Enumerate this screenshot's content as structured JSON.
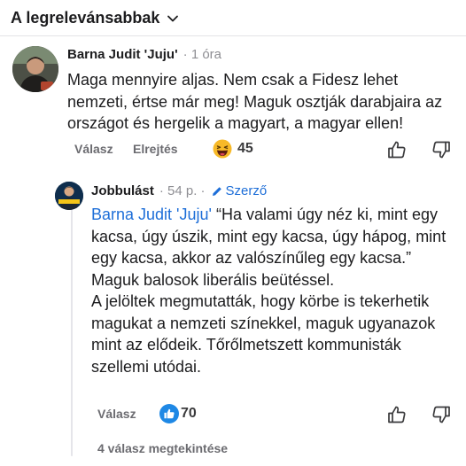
{
  "sort": {
    "label": "A legrelevánsabbak",
    "icon": "chevron-down-icon"
  },
  "comments": [
    {
      "author": "Barna Judit 'Juju'",
      "time": "· 1 óra",
      "text": "Maga mennyire aljas. Nem csak a Fidesz lehet nemzeti, értse már meg! Maguk osztják darabjaira az országot és hergelik a magyart, a magyar ellen!",
      "reply_label": "Válasz",
      "hide_label": "Elrejtés",
      "reaction_icon": "laughing-emoji-icon",
      "reaction_count": "45"
    },
    {
      "author": "Jobbulást",
      "time": "· 54 p. ·",
      "author_badge": "Szerző",
      "author_badge_icon": "pencil-icon",
      "mention": "Barna Judit 'Juju'",
      "text": " “Ha valami úgy néz ki, mint egy kacsa, úgy úszik, mint egy kacsa, úgy hápog, mint egy kacsa, akkor az valószínűleg egy kacsa.”\nMaguk balosok liberális beütéssel.\nA jelöltek megmutatták, hogy körbe is tekerhetik magukat a nemzeti színekkel, maguk ugyanazok mint az elődeik. Tőrőlmetszett kommunisták szellemi utódai.",
      "reply_label": "Válasz",
      "reaction_icon": "thumbs-up-icon",
      "reaction_count": "70"
    }
  ],
  "view_replies": "4 válasz megtekintése",
  "colors": {
    "link": "#1d6ed8",
    "like_badge": "#1e88e5",
    "emoji": "#f7b928",
    "text": "#1c1c1e",
    "muted": "#6b6b70"
  }
}
